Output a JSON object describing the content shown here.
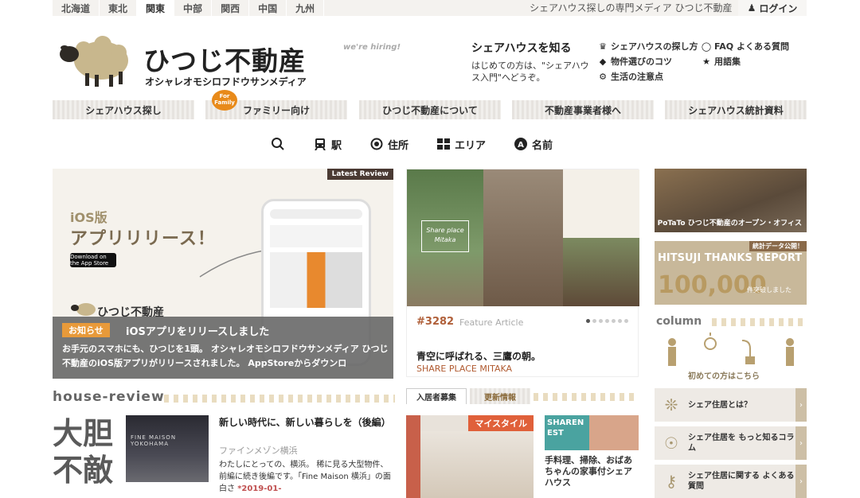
{
  "region_bar": {
    "regions": [
      "北海道",
      "東北",
      "関東",
      "中部",
      "関西",
      "中国",
      "九州"
    ],
    "active": "関東",
    "tagline": "シェアハウス探しの専門メディア ひつじ不動産",
    "login_label": "ログイン",
    "login_icon": "person-icon"
  },
  "header": {
    "logo_text": "ひつじ不動産",
    "logo_sub": "オシャレオモシロフドウサンメディア",
    "hiring": "we're hiring!",
    "know_title": "シェアハウスを知る",
    "know_desc": "はじめての方は、\"シェアハウス入門\"へどうぞ。",
    "links": [
      {
        "icon": "crown-icon",
        "label": "シェアハウスの探し方"
      },
      {
        "icon": "q-icon",
        "label": "FAQ よくある質問"
      },
      {
        "icon": "diamond-icon",
        "label": "物件選びのコツ"
      },
      {
        "icon": "star-icon",
        "label": "用語集"
      },
      {
        "icon": "gear-icon",
        "label": "生活の注意点"
      }
    ]
  },
  "nav": {
    "items": [
      "シェアハウス探し",
      "ファミリー向け",
      "ひつじ不動産について",
      "不動産事業者様へ",
      "シェアハウス統計資料"
    ],
    "family_badge": "For Family"
  },
  "search": {
    "items": [
      {
        "icon": "search-icon",
        "label": ""
      },
      {
        "icon": "train-icon",
        "label": "駅"
      },
      {
        "icon": "target-icon",
        "label": "住所"
      },
      {
        "icon": "grid-icon",
        "label": "エリア"
      },
      {
        "icon": "a-circle-icon",
        "label": "名前"
      }
    ]
  },
  "hero": {
    "badge": "Latest Review",
    "ios_label": "iOS版",
    "ios_title": "アプリリリース！",
    "appstore": "Download on the App Store",
    "sheep_text": "ひつじ不動産",
    "notice_badge": "お知らせ",
    "title": "iOSアプリをリリースしました",
    "desc": "お手元のスマホにも、ひつじを1頭。 オシャレオモシロフドウサンメディア ひつじ不動産のiOS版アプリがリリースされました。 AppStoreからダウンロ"
  },
  "feature": {
    "number": "#3282",
    "type": "Feature Article",
    "photo_text": "Share place Mitaka",
    "title": "青空に呼ばれる、三鷹の朝。",
    "name": "SHARE PLACE MITAKA",
    "dots": 7
  },
  "right": {
    "photo1_text": "PoTaTo ひつじ不動産のオープン・オフィス",
    "photo2_badge": "統計データ公開！",
    "photo2_big": "100,000",
    "photo2_sub": "件突破しました",
    "photo2_head": "HITSUJI THANKS REPORT",
    "column_title": "column",
    "column_sub": "初めての方はこちら",
    "boxes": [
      {
        "icon": "bulb-icon",
        "label": "シェア住居とは？"
      },
      {
        "icon": "plug-icon",
        "label": "シェア住居を もっと知るコラム"
      },
      {
        "icon": "key-icon",
        "label": "シェア住居に関する よくある質問"
      }
    ]
  },
  "house_review": {
    "title": "house-review",
    "bold_word": "大胆不敵",
    "photo_text": "FINE MAISON YOKOHAMA",
    "article_title": "新しい時代に、新しい暮らしを（後編）",
    "article_name": "ファインメゾン横浜",
    "article_desc": "わたしにとっての、横浜。 稀に見る大型物件、前編に続き後編です。「Fine Maison 横浜」の面白さ",
    "date": "*2019-01-"
  },
  "bottom_mid": {
    "tabs": [
      "入居者募集",
      "更新情報"
    ],
    "mystyle": "マイスタイル",
    "sharenest": "SHARENEST",
    "sharenest_text": "手料理、掃除、おばあちゃんの家事付シェアハウス"
  }
}
